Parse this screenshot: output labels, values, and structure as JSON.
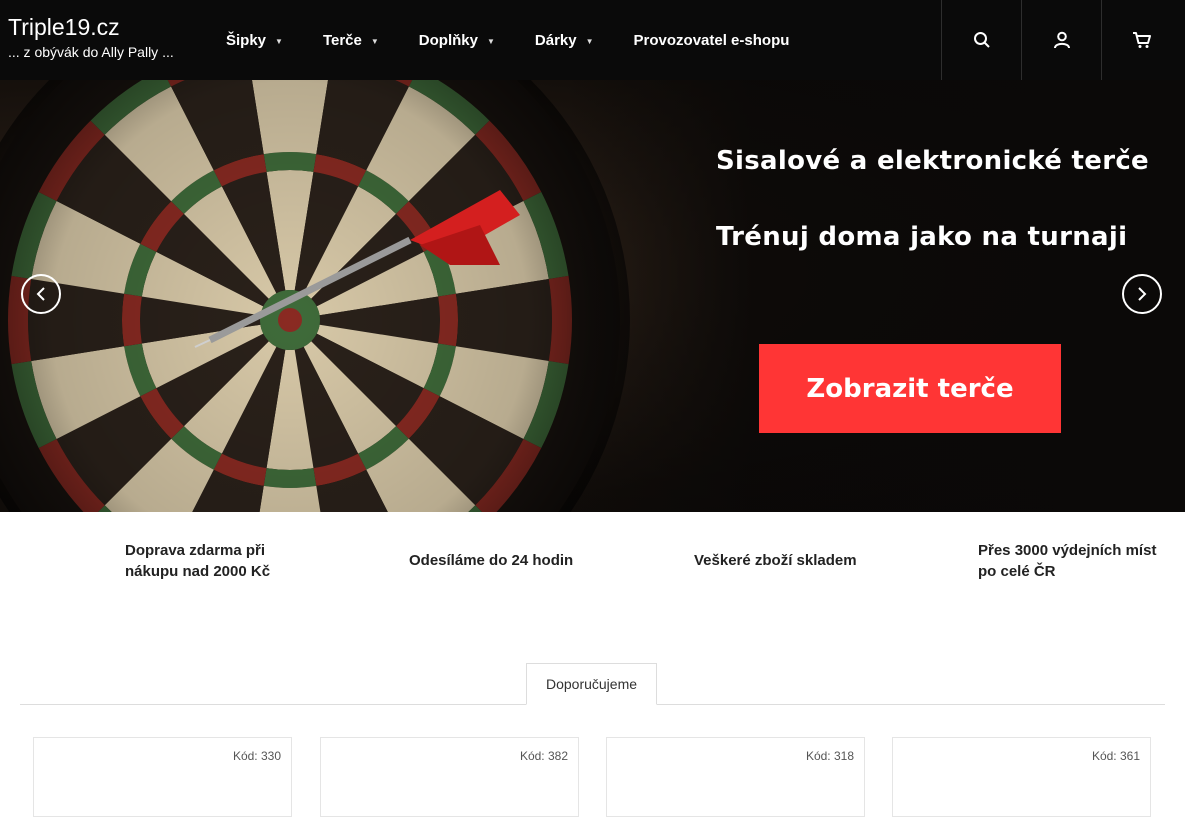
{
  "header": {
    "brand_title": "Triple19.cz",
    "brand_subtitle": "... z obývák do Ally Pally ...",
    "nav": [
      {
        "label": "Šipky",
        "has_dropdown": true
      },
      {
        "label": "Terče",
        "has_dropdown": true
      },
      {
        "label": "Doplňky",
        "has_dropdown": true
      },
      {
        "label": "Dárky",
        "has_dropdown": true
      },
      {
        "label": "Provozovatel e-shopu",
        "has_dropdown": false
      }
    ],
    "icons": [
      "search-icon",
      "user-icon",
      "cart-icon"
    ]
  },
  "hero": {
    "line1": "Sisalové a elektronické terče",
    "line2": "Trénuj doma jako na turnaji",
    "cta": "Zobrazit terče",
    "cta_color": "#ff3535"
  },
  "benefits": [
    "Doprava zdarma při nákupu nad 2000 Kč",
    "Odesíláme do 24 hodin",
    "Veškeré zboží skladem",
    "Přes 3000 výdejních míst po celé ČR"
  ],
  "tabs": {
    "active": "Doporučujeme"
  },
  "products": [
    {
      "code": "Kód: 330"
    },
    {
      "code": "Kód: 382"
    },
    {
      "code": "Kód: 318"
    },
    {
      "code": "Kód: 361"
    }
  ]
}
